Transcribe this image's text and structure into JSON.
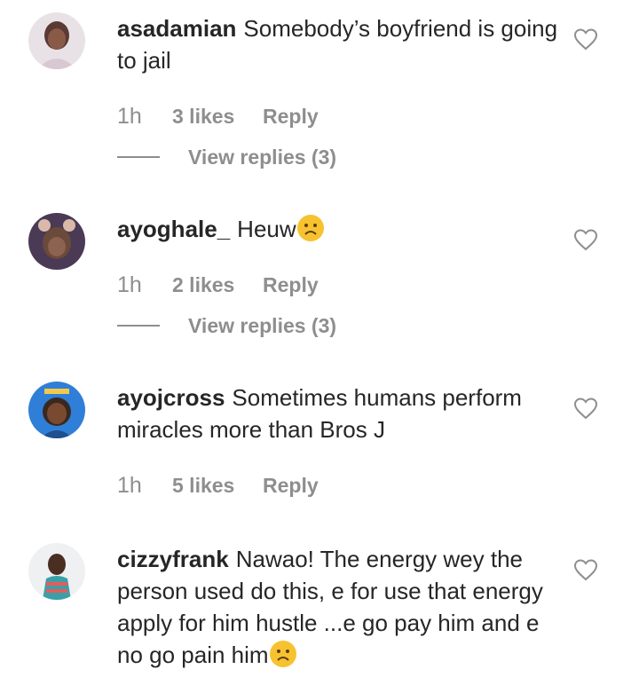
{
  "comments": [
    {
      "username": "asadamian",
      "text": "Somebody’s boyfriend is going to jail",
      "time": "1h",
      "likes": "3 likes",
      "reply": "Reply",
      "view_replies": "View replies (3)"
    },
    {
      "username": "ayoghale_",
      "text": "Heuw",
      "emoji": "sad-face-emoji",
      "time": "1h",
      "likes": "2 likes",
      "reply": "Reply",
      "view_replies": "View replies (3)"
    },
    {
      "username": "ayojcross",
      "text": "Sometimes humans perform miracles more than Bros J",
      "time": "1h",
      "likes": "5 likes",
      "reply": "Reply"
    },
    {
      "username": "cizzyfrank",
      "text": "Nawao! The energy wey the person used do this, e for use that energy apply for him hustle ...e go pay him and e no go pain him",
      "emoji": "sad-face-emoji"
    }
  ],
  "icons": {
    "like": "heart-outline-icon"
  },
  "colors": {
    "text": "#262626",
    "muted": "#8e8e8e",
    "background": "#ffffff"
  }
}
